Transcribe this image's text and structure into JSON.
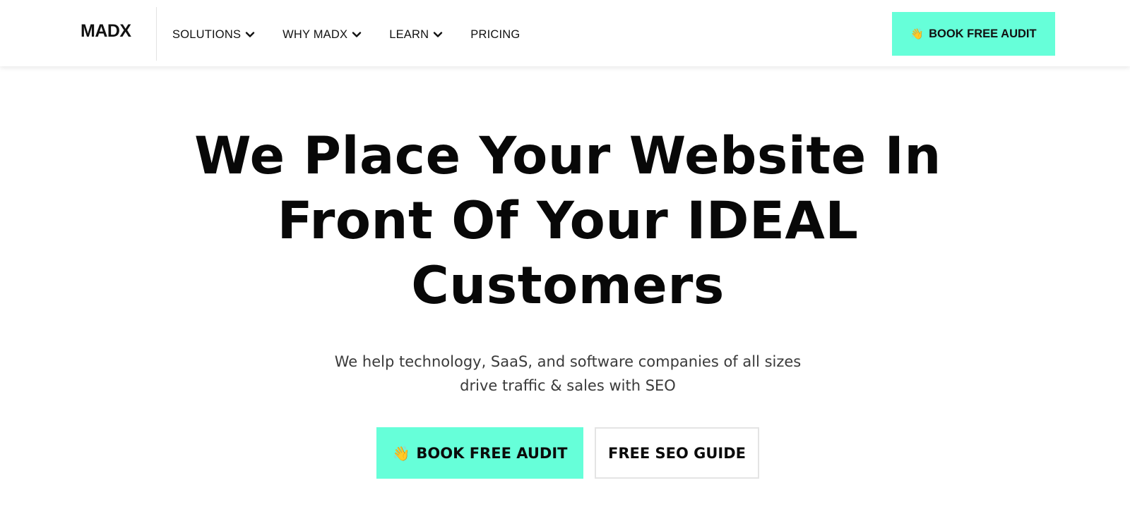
{
  "header": {
    "logo": "MADX",
    "nav": [
      {
        "label": "SOLUTIONS",
        "has_dropdown": true,
        "icon": "chevron-down-icon"
      },
      {
        "label": "WHY MADX",
        "has_dropdown": true,
        "icon": "chevron-down-icon"
      },
      {
        "label": "LEARN",
        "has_dropdown": true,
        "icon": "chevron-down-icon"
      },
      {
        "label": "PRICING",
        "has_dropdown": false
      }
    ],
    "cta": {
      "icon": "waving-hand-icon",
      "emoji": "👋",
      "label": "BOOK FREE AUDIT"
    }
  },
  "hero": {
    "title": "We Place Your Website In Front Of Your IDEAL Customers",
    "subtitle_line1": "We help technology, SaaS, and software companies of all sizes",
    "subtitle_line2": "drive traffic & sales with SEO",
    "primary_button": {
      "icon": "waving-hand-icon",
      "emoji": "👋",
      "label": "BOOK FREE AUDIT"
    },
    "secondary_button": {
      "label": "FREE SEO GUIDE"
    }
  },
  "colors": {
    "accent": "#66ffd9",
    "text": "#0b0b0b",
    "subtext": "#3a3a3a",
    "border": "#e4e4e4"
  }
}
